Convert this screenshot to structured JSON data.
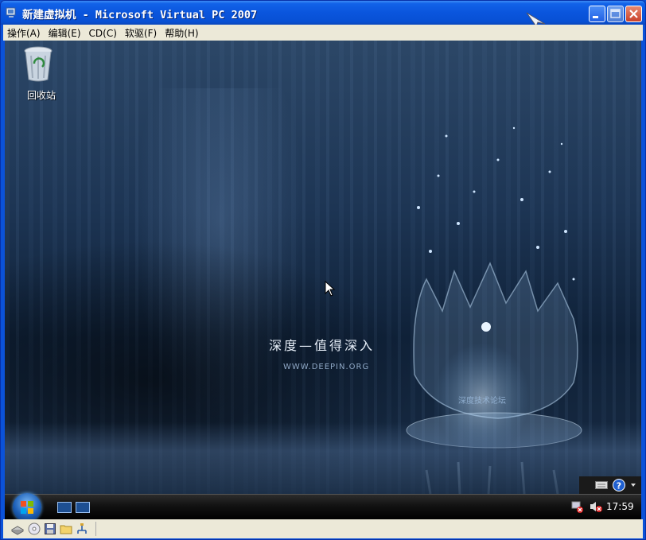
{
  "window": {
    "title": "新建虚拟机 - Microsoft Virtual PC 2007",
    "controls": {
      "minimize": "minimize",
      "maximize": "maximize",
      "close": "close"
    }
  },
  "menu": [
    {
      "label": "操作(A)"
    },
    {
      "label": "编辑(E)"
    },
    {
      "label": "CD(C)"
    },
    {
      "label": "软驱(F)"
    },
    {
      "label": "帮助(H)"
    }
  ],
  "desktop": {
    "icons": [
      {
        "label": "回收站",
        "icon": "recycle-bin-icon"
      }
    ],
    "wallpaper": {
      "slogan": "深度—值得深入",
      "domain": "WWW.DEEPIN.ORG",
      "forum": "深度技术论坛"
    }
  },
  "taskbar": {
    "quick_launch": [
      "show-desktop-icon",
      "switch-windows-icon"
    ],
    "tray_icons": [
      "network-error-icon",
      "volume-muted-icon"
    ],
    "clock": "17:59"
  },
  "statusbar": {
    "icons": [
      "hard-disk-icon",
      "cd-drive-icon",
      "floppy-drive-icon",
      "shared-folder-icon",
      "network-adapter-icon"
    ]
  },
  "colors": {
    "titlebar": "#0a55dd",
    "menubar": "#ece9d8",
    "desktop": "#1d3554"
  }
}
